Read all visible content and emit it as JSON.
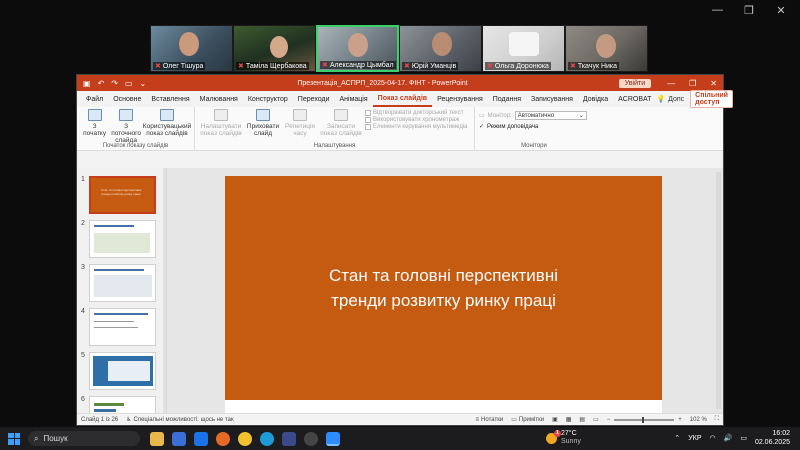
{
  "zoom_controls": {
    "minimize": "—",
    "restore": "❐",
    "close": "✕"
  },
  "participants": [
    {
      "name": "Олег Тішура",
      "muted": true
    },
    {
      "name": "Тамiла Щербакова",
      "muted": true
    },
    {
      "name": "Александр Цымбал",
      "muted": true,
      "active": true
    },
    {
      "name": "Юрій Уманців",
      "muted": true
    },
    {
      "name": "Ольга Доронюка",
      "muted": true
    },
    {
      "name": "Ткачук Ника",
      "muted": true
    }
  ],
  "ppt": {
    "doc_title": "Презентація_АСПРП_2025-04-17. ФІНТ  -  PowerPoint",
    "sign_in": "Увійти",
    "menu": [
      "Файл",
      "Основне",
      "Вставлення",
      "Малювання",
      "Конструктор",
      "Переходи",
      "Анімація",
      "Показ слайдів",
      "Рецензування",
      "Подання",
      "Записування",
      "Довідка",
      "ACROBAT"
    ],
    "active_menu": "Показ слайдів",
    "notes_btn": "Допс",
    "share": "Спільний доступ",
    "ribbon": {
      "start_group": {
        "label": "Початок показу слайдів",
        "buttons": [
          "З початку",
          "З поточного слайда",
          "Користувацький показ слайдів"
        ]
      },
      "setup_group": {
        "label": "Налаштування",
        "buttons": [
          "Налаштувати показ слайдів",
          "Приховати слайд",
          "Репетиція часу",
          "Записати показ слайдів"
        ],
        "checks": [
          "Відтворювати дикторський текст",
          "Використовувати хронометраж",
          "Елементи керування мультимедіа"
        ]
      },
      "monitors_group": {
        "label": "Монітори",
        "monitor_label": "Монітор:",
        "monitor_value": "Автоматично",
        "presenter_view": "Режим доповідача"
      }
    },
    "thumbnails": [
      {
        "num": "1",
        "selected": true,
        "text": "Стан та головні перспективні тренди розвитку ринку праці"
      },
      {
        "num": "2"
      },
      {
        "num": "3"
      },
      {
        "num": "4"
      },
      {
        "num": "5"
      },
      {
        "num": "6"
      }
    ],
    "slide_title_line1": "Стан та головні перспективні",
    "slide_title_line2": "тренди розвитку ринку праці",
    "status": {
      "slide_info": "Слайд 1 із 26",
      "accessibility": "Спеціальні можливості: щось не так",
      "notes": "Нотатки",
      "comments": "Примітки",
      "zoom": "102 %"
    }
  },
  "taskbar": {
    "search": "Пошук",
    "weather_temp": "27°C",
    "weather_desc": "Sunny",
    "weather_badge": "1",
    "lang": "УКР",
    "time": "16:02",
    "date": "02.06.2025"
  },
  "colors": {
    "accent": "#c43e1c",
    "slide_bg": "#c55a11",
    "active_tile": "#3ad16a"
  }
}
